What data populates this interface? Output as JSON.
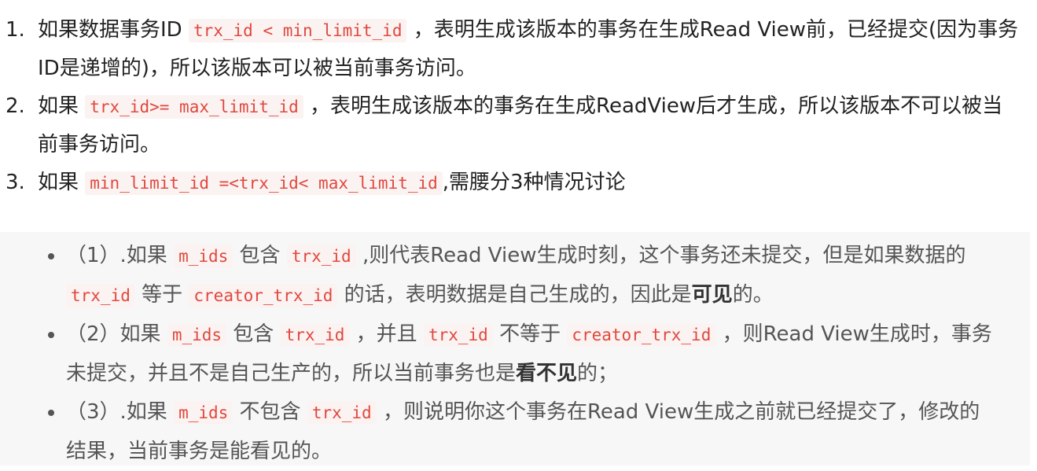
{
  "ordered_list": [
    {
      "marker": "1.",
      "segments": [
        {
          "t": "如果数据事务ID "
        },
        {
          "c": "trx_id < min_limit_id"
        },
        {
          "t": " ，表明生成该版本的事务在生成Read View前，已经提交(因为事务ID是递增的)，所以该版本可以被当前事务访问。"
        }
      ]
    },
    {
      "marker": "2.",
      "segments": [
        {
          "t": "如果 "
        },
        {
          "c": "trx_id>= max_limit_id"
        },
        {
          "t": " ，表明生成该版本的事务在生成ReadView后才生成，所以该版本不可以被当前事务访问。"
        }
      ]
    },
    {
      "marker": "3.",
      "segments": [
        {
          "t": "如果 "
        },
        {
          "c": "min_limit_id =<trx_id< max_limit_id"
        },
        {
          "t": ",需腰分3种情况讨论"
        }
      ]
    }
  ],
  "bullet_list": [
    {
      "segments": [
        {
          "t": "（1）.如果 "
        },
        {
          "c": "m_ids"
        },
        {
          "t": " 包含 "
        },
        {
          "c": "trx_id"
        },
        {
          "t": " ,则代表Read View生成时刻，这个事务还未提交，但是如果数据的 "
        },
        {
          "c": "trx_id"
        },
        {
          "t": " 等于 "
        },
        {
          "c": "creator_trx_id"
        },
        {
          "t": " 的话，表明数据是自己生成的，因此是"
        },
        {
          "b": "可见"
        },
        {
          "t": "的。"
        }
      ]
    },
    {
      "segments": [
        {
          "t": "（2）如果 "
        },
        {
          "c": "m_ids"
        },
        {
          "t": " 包含 "
        },
        {
          "c": "trx_id"
        },
        {
          "t": " ，并且 "
        },
        {
          "c": "trx_id"
        },
        {
          "t": " 不等于 "
        },
        {
          "c": "creator_trx_id"
        },
        {
          "t": " ，则Read View生成时，事务未提交，并且不是自己生产的，所以当前事务也是"
        },
        {
          "b": "看不见"
        },
        {
          "t": "的；"
        }
      ]
    },
    {
      "segments": [
        {
          "t": "（3）.如果 "
        },
        {
          "c": "m_ids"
        },
        {
          "t": " 不包含 "
        },
        {
          "c": "trx_id"
        },
        {
          "t": " ，则说明你这个事务在Read View生成之前就已经提交了，修改的结果，当前事务是能看见的。"
        }
      ]
    }
  ]
}
